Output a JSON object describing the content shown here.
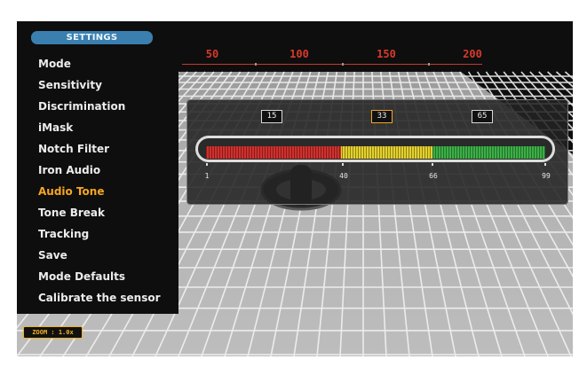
{
  "sidebar": {
    "title": "SETTINGS",
    "items": [
      {
        "label": "Mode"
      },
      {
        "label": "Sensitivity"
      },
      {
        "label": "Discrimination"
      },
      {
        "label": "iMask"
      },
      {
        "label": "Notch Filter"
      },
      {
        "label": "Iron Audio"
      },
      {
        "label": "Audio Tone",
        "active": true
      },
      {
        "label": "Tone Break"
      },
      {
        "label": "Tracking"
      },
      {
        "label": "Save"
      },
      {
        "label": "Mode Defaults"
      },
      {
        "label": "Calibrate the sensor"
      }
    ]
  },
  "depth_scale": {
    "labels": [
      "50",
      "100",
      "150",
      "200"
    ],
    "color": "#d83a2a"
  },
  "tone_panel": {
    "values": [
      "15",
      "33",
      "65"
    ],
    "selected_index": 1,
    "bar_labels": [
      "1",
      "40",
      "66",
      "99"
    ],
    "zones": [
      {
        "color": "#d0312d",
        "range": [
          1,
          40
        ]
      },
      {
        "color": "#e4d12c",
        "range": [
          40,
          66
        ]
      },
      {
        "color": "#3bb046",
        "range": [
          66,
          99
        ]
      }
    ]
  },
  "coil_icon": "search-coil-icon",
  "zoom": {
    "label": "ZOOM : 1.0x"
  },
  "colors": {
    "accent": "#f6a623",
    "settings_header": "#3a7fb0"
  }
}
